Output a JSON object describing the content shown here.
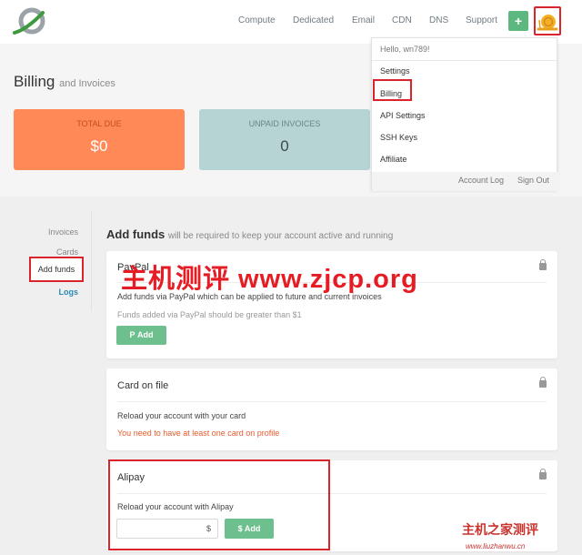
{
  "nav": {
    "items": [
      "Compute",
      "Dedicated",
      "Email",
      "CDN",
      "DNS",
      "Support"
    ],
    "add_label": "+"
  },
  "dropdown": {
    "greeting": "Hello, wn789!",
    "items": [
      "Settings",
      "Billing",
      "API Settings",
      "SSH Keys",
      "Affiliate"
    ],
    "footer_links": [
      "Account Log",
      "Sign Out"
    ]
  },
  "page": {
    "title": "Billing",
    "subtitle": "and Invoices"
  },
  "summary": {
    "total_due_label": "TOTAL DUE",
    "total_due_value": "$0",
    "unpaid_label": "UNPAID INVOICES",
    "unpaid_value": "0"
  },
  "sidebar": {
    "items": [
      "Invoices",
      "Cards",
      "Add funds",
      "Logs"
    ]
  },
  "main": {
    "title": "Add funds",
    "subtitle": "will be required to keep your account active and running",
    "paypal": {
      "title": "PayPal",
      "desc": "Add funds via PayPal which can be applied to future and current invoices",
      "note": "Funds added via PayPal should be greater than $1",
      "button": "Add"
    },
    "card": {
      "title": "Card on file",
      "desc": "Reload your account with your card",
      "warning": "You need to have at least one card on profile"
    },
    "alipay": {
      "title": "Alipay",
      "desc": "Reload your account with Alipay",
      "currency": "$",
      "button": "$ Add"
    }
  },
  "watermark": {
    "main": "主机测评 www.zjcp.org",
    "corner": "主机之家测评",
    "corner_url": "www.liuzhanwu.cn"
  },
  "colors": {
    "accent_green": "#6dbf8d",
    "total_due_bg": "#ff8a57",
    "unpaid_bg": "#b5d4d3",
    "highlight_red": "#d9242b"
  }
}
